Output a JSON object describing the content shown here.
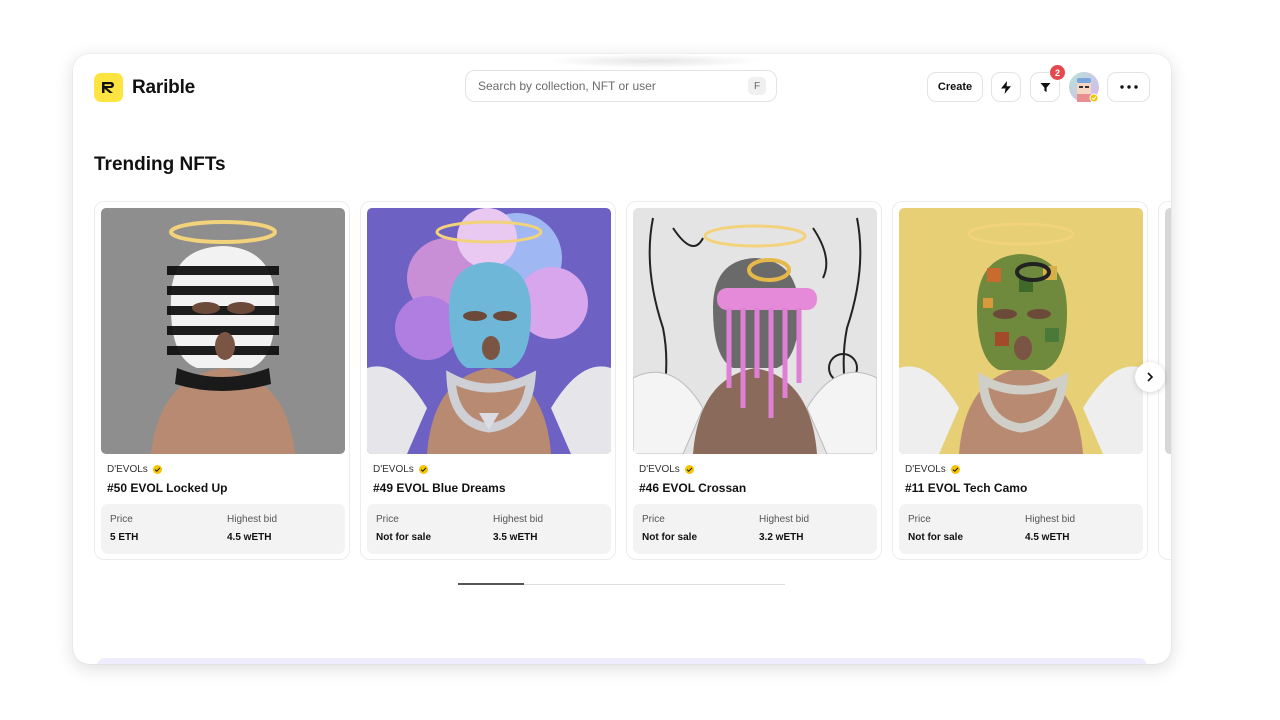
{
  "app": {
    "name": "Rarible"
  },
  "search": {
    "placeholder": "Search by collection, NFT or user",
    "shortcut": "F"
  },
  "header": {
    "create_label": "Create",
    "filter_badge": "2",
    "more_label": "···"
  },
  "section": {
    "title": "Trending NFTs"
  },
  "cards": [
    {
      "collection": "D'EVOLs",
      "name": "#50 EVOL Locked Up",
      "price_label": "Price",
      "price": "5 ETH",
      "bid_label": "Highest bid",
      "bid": "4.5 wETH",
      "bg": "#8f8f8f"
    },
    {
      "collection": "D'EVOLs",
      "name": "#49 EVOL Blue Dreams",
      "price_label": "Price",
      "price": "Not for sale",
      "bid_label": "Highest bid",
      "bid": "3.5 wETH",
      "bg": "#6f63c6"
    },
    {
      "collection": "D'EVOLs",
      "name": "#46 EVOL Crossan",
      "price_label": "Price",
      "price": "Not for sale",
      "bid_label": "Highest bid",
      "bid": "3.2 wETH",
      "bg": "#e6e6e6"
    },
    {
      "collection": "D'EVOLs",
      "name": "#11 EVOL Tech Camo",
      "price_label": "Price",
      "price": "Not for sale",
      "bid_label": "Highest bid",
      "bid": "4.5 wETH",
      "bg": "#e7cf75"
    }
  ],
  "colors": {
    "brand": "#fee440",
    "badge": "#e5484d",
    "verified": "#f4c400"
  }
}
